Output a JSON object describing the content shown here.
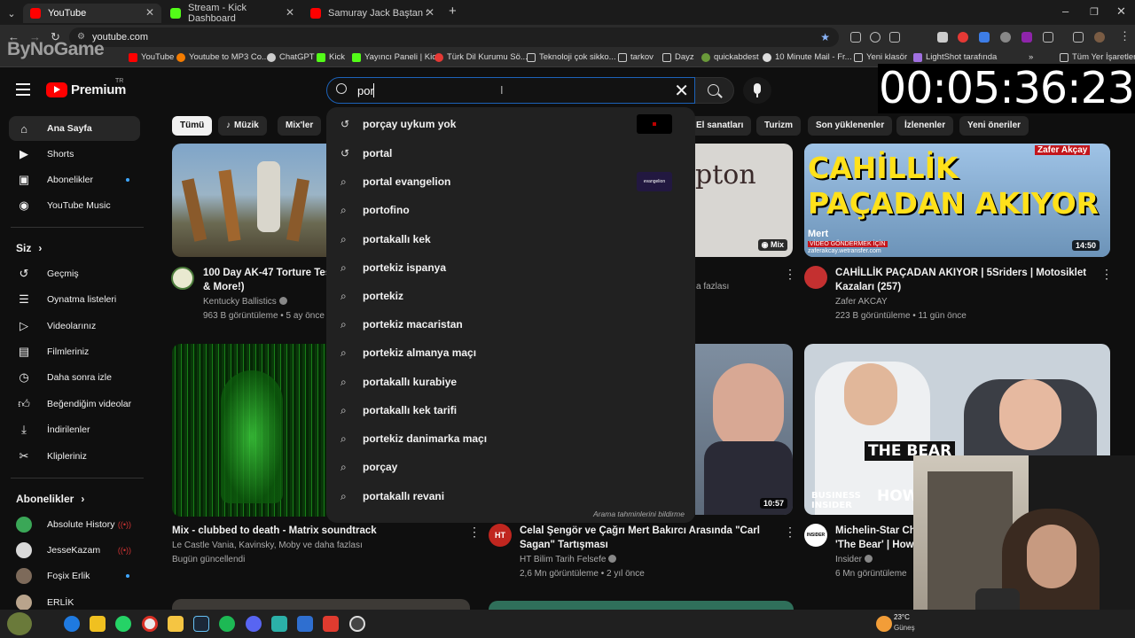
{
  "browser": {
    "tabs": [
      {
        "title": "YouTube",
        "icon": "youtube-icon",
        "color": "#ff0000"
      },
      {
        "title": "Stream - Kick Dashboard",
        "icon": "kick-icon",
        "color": "#53fc18"
      },
      {
        "title": "Samuray Jack Baştan Sona Tüm",
        "icon": "youtube-icon",
        "color": "#ff0000"
      }
    ],
    "url": "youtube.com",
    "bookmarks": [
      "YouTube",
      "Youtube to MP3 Co...",
      "ChatGPT",
      "Kick",
      "Yayıncı Paneli | Kick",
      "Türk Dil Kurumu Sö...",
      "Teknoloji çok sikko...",
      "tarkov",
      "Dayz",
      "quickabdest",
      "10 Minute Mail - Fr...",
      "Yeni klasör",
      "LightShot tarafında",
      "Tüm Yer İşaretleri"
    ],
    "overlay_logo": "ByNoGame"
  },
  "stream_timer": "00:05:36:23",
  "header": {
    "logo_text": "Premium",
    "country": "TR",
    "search_query": "por"
  },
  "sidebar": {
    "main": [
      {
        "label": "Ana Sayfa",
        "icon": "home-icon"
      },
      {
        "label": "Shorts",
        "icon": "shorts-icon"
      },
      {
        "label": "Abonelikler",
        "icon": "subscriptions-icon"
      },
      {
        "label": "YouTube Music",
        "icon": "music-icon"
      }
    ],
    "you_heading": "Siz",
    "you": [
      {
        "label": "Geçmiş",
        "icon": "history-icon"
      },
      {
        "label": "Oynatma listeleri",
        "icon": "playlists-icon"
      },
      {
        "label": "Videolarınız",
        "icon": "your-videos-icon"
      },
      {
        "label": "Filmleriniz",
        "icon": "movies-icon"
      },
      {
        "label": "Daha sonra izle",
        "icon": "watch-later-icon"
      },
      {
        "label": "Beğendiğim videolar",
        "icon": "liked-icon"
      },
      {
        "label": "İndirilenler",
        "icon": "downloads-icon"
      },
      {
        "label": "Klipleriniz",
        "icon": "clips-icon"
      }
    ],
    "subs_heading": "Abonelikler",
    "subs": [
      {
        "label": "Absolute History",
        "color": "#3aa757"
      },
      {
        "label": "JesseKazam",
        "color": "#d9d9d9"
      },
      {
        "label": "Foşix Erlik",
        "color": "#7d6a5a"
      },
      {
        "label": "ERLİK",
        "color": "#b9a48c"
      }
    ]
  },
  "chips": [
    "Tümü",
    "Müzik",
    "Mix'ler",
    "El sanatları",
    "Turizm",
    "Son yüklenenler",
    "İzlenenler",
    "Yeni öneriler"
  ],
  "videos": [
    {
      "title_line1": "100 Day AK-47 Torture Tes",
      "title_line2": "& More!)",
      "channel": "Kentucky Ballistics",
      "meta": "963 B görüntüleme • 5 ay önce"
    },
    {
      "meta": "a fazlası",
      "duration_label": "Mix"
    },
    {
      "title_line1": "CAHİLLİK PAÇADAN AKIYOR | 5Sriders | Motosiklet",
      "title_line2": "Kazaları (257)",
      "channel": "Zafer AKCAY",
      "meta": "223 B görüntüleme • 11 gün önce",
      "duration": "14:50",
      "thumb_big1": "CAHİLLİK",
      "thumb_big2": "PAÇADAN AKIYOR",
      "thumb_small1": "Mert",
      "thumb_small2": "VİDEO GÖNDERMEK İÇİN",
      "thumb_small3": "zaferakcay.wetransfer.com",
      "thumb_name": "Zafer Akçay"
    },
    {
      "title_line1": "Mix - clubbed to death - Matrix soundtrack",
      "channel": "Le Castle Vania, Kavinsky, Moby ve daha fazlası",
      "meta": "Bugün güncellendi"
    },
    {
      "title_line1": "Celal Şengör ve Çağrı Mert Bakırcı Arasında \"Carl",
      "title_line2": "Sagan\" Tartışması",
      "channel": "HT Bilim Tarih Felsefe",
      "meta": "2,6 Mn görüntüleme • 2 yıl önce",
      "duration": "10:57",
      "avatar_text": "HT"
    },
    {
      "title_line1": "Michelin-Star Ch",
      "title_line2": "'The Bear' | How I",
      "channel": "Insider",
      "meta": "6 Mn görüntüleme",
      "thumb_text1": "THE BEAR",
      "thumb_text2": "BUSINESS INSIDER",
      "thumb_text3": "HOW",
      "avatar_text": "INSIDER"
    }
  ],
  "suggestions": [
    {
      "text": "porçay uykum yok",
      "icon": "history-icon"
    },
    {
      "text": "portal",
      "icon": "history-icon"
    },
    {
      "text": "portal evangelion",
      "icon": "search-icon"
    },
    {
      "text": "portofino",
      "icon": "search-icon"
    },
    {
      "text": "portakallı kek",
      "icon": "search-icon"
    },
    {
      "text": "portekiz ispanya",
      "icon": "search-icon"
    },
    {
      "text": "portekiz",
      "icon": "search-icon"
    },
    {
      "text": "portekiz macaristan",
      "icon": "search-icon"
    },
    {
      "text": "portekiz almanya maçı",
      "icon": "search-icon"
    },
    {
      "text": "portakallı kurabiye",
      "icon": "search-icon"
    },
    {
      "text": "portakallı kek tarifi",
      "icon": "search-icon"
    },
    {
      "text": "portekiz danimarka maçı",
      "icon": "search-icon"
    },
    {
      "text": "porçay",
      "icon": "search-icon"
    },
    {
      "text": "portakallı revani",
      "icon": "search-icon"
    }
  ],
  "suggestions_footer": "Arama tahminlerini bildirme",
  "suggestion_thumb_text": "evangelion",
  "partial": {
    "thumb_pton": "pton"
  },
  "taskbar": {
    "weather_temp": "23°C",
    "weather_label": "Güneş"
  }
}
